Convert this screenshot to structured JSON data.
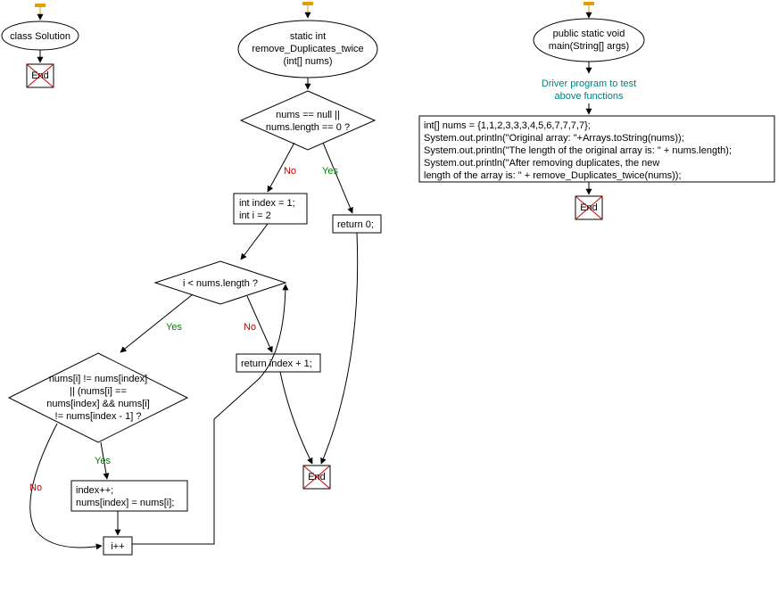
{
  "chart_data": {
    "type": "flowchart",
    "columns": [
      {
        "id": "col1",
        "nodes": [
          {
            "id": "c1_start",
            "type": "start"
          },
          {
            "id": "c1_class",
            "type": "oval",
            "text": "class Solution"
          },
          {
            "id": "c1_end",
            "type": "end"
          }
        ],
        "edges": [
          {
            "from": "c1_start",
            "to": "c1_class"
          },
          {
            "from": "c1_class",
            "to": "c1_end"
          }
        ]
      },
      {
        "id": "col2",
        "nodes": [
          {
            "id": "c2_start",
            "type": "start"
          },
          {
            "id": "c2_func",
            "type": "oval",
            "text_lines": [
              "static int",
              "remove_Duplicates_twice",
              "(int[] nums)"
            ]
          },
          {
            "id": "c2_d1",
            "type": "decision",
            "text_lines": [
              "nums == null ||",
              "nums.length == 0 ?"
            ]
          },
          {
            "id": "c2_ret0",
            "type": "process",
            "text": "return 0;"
          },
          {
            "id": "c2_init",
            "type": "process",
            "text_lines": [
              "int index = 1;",
              "int i = 2"
            ]
          },
          {
            "id": "c2_d2",
            "type": "decision",
            "text": "i < nums.length ?"
          },
          {
            "id": "c2_retidx",
            "type": "process",
            "text": "return index + 1;"
          },
          {
            "id": "c2_d3",
            "type": "decision",
            "text_lines": [
              "nums[i] != nums[index]",
              "|| (nums[i] ==",
              "nums[index] && nums[i]",
              "!= nums[index - 1] ?"
            ]
          },
          {
            "id": "c2_assign",
            "type": "process",
            "text_lines": [
              "index++;",
              "nums[index] = nums[i];"
            ]
          },
          {
            "id": "c2_inc",
            "type": "process",
            "text": "i++"
          },
          {
            "id": "c2_end",
            "type": "end"
          }
        ],
        "edges": [
          {
            "from": "c2_start",
            "to": "c2_func"
          },
          {
            "from": "c2_func",
            "to": "c2_d1"
          },
          {
            "from": "c2_d1",
            "to": "c2_ret0",
            "label": "Yes"
          },
          {
            "from": "c2_d1",
            "to": "c2_init",
            "label": "No"
          },
          {
            "from": "c2_init",
            "to": "c2_d2"
          },
          {
            "from": "c2_d2",
            "to": "c2_d3",
            "label": "Yes"
          },
          {
            "from": "c2_d2",
            "to": "c2_retidx",
            "label": "No"
          },
          {
            "from": "c2_d3",
            "to": "c2_assign",
            "label": "Yes"
          },
          {
            "from": "c2_d3",
            "to": "c2_inc",
            "label": "No"
          },
          {
            "from": "c2_assign",
            "to": "c2_inc"
          },
          {
            "from": "c2_inc",
            "to": "c2_d2"
          },
          {
            "from": "c2_ret0",
            "to": "c2_end"
          },
          {
            "from": "c2_retidx",
            "to": "c2_end"
          }
        ]
      },
      {
        "id": "col3",
        "nodes": [
          {
            "id": "c3_start",
            "type": "start"
          },
          {
            "id": "c3_main",
            "type": "oval",
            "text_lines": [
              "public static void",
              "main(String[] args)"
            ]
          },
          {
            "id": "c3_comment",
            "type": "comment",
            "text_lines": [
              "Driver program to test",
              "above functions"
            ]
          },
          {
            "id": "c3_body",
            "type": "process",
            "text_lines": [
              "int[] nums = {1,1,2,3,3,3,4,5,6,7,7,7,7};",
              "System.out.println(\"Original array: \"+Arrays.toString(nums));",
              "System.out.println(\"The length of the original array is: \" + nums.length);",
              "System.out.println(\"After removing duplicates, the new",
              "length of the array is: \" + remove_Duplicates_twice(nums));"
            ]
          },
          {
            "id": "c3_end",
            "type": "end"
          }
        ],
        "edges": [
          {
            "from": "c3_start",
            "to": "c3_main"
          },
          {
            "from": "c3_main",
            "to": "c3_comment"
          },
          {
            "from": "c3_comment",
            "to": "c3_body"
          },
          {
            "from": "c3_body",
            "to": "c3_end"
          }
        ]
      }
    ]
  },
  "labels": {
    "yes": "Yes",
    "no": "No"
  },
  "col1": {
    "class": "class Solution",
    "end": "End"
  },
  "col2": {
    "func_l1": "static int",
    "func_l2": "remove_Duplicates_twice",
    "func_l3": "(int[] nums)",
    "d1_l1": "nums == null ||",
    "d1_l2": "nums.length == 0 ?",
    "ret0": "return 0;",
    "init_l1": "int index = 1;",
    "init_l2": "int i = 2",
    "d2": "i < nums.length ?",
    "retidx": "return index + 1;",
    "d3_l1": "nums[i] != nums[index]",
    "d3_l2": "|| (nums[i] ==",
    "d3_l3": "nums[index] && nums[i]",
    "d3_l4": "!= nums[index - 1] ?",
    "assign_l1": "index++;",
    "assign_l2": "nums[index] = nums[i];",
    "inc": "i++",
    "end": "End"
  },
  "col3": {
    "main_l1": "public static void",
    "main_l2": "main(String[] args)",
    "comment_l1": "Driver program to test",
    "comment_l2": "above functions",
    "body_l1": "int[] nums = {1,1,2,3,3,3,4,5,6,7,7,7,7};",
    "body_l2": "System.out.println(\"Original array: \"+Arrays.toString(nums));",
    "body_l3": "System.out.println(\"The length of the original array is: \" + nums.length);",
    "body_l4": "System.out.println(\"After removing duplicates, the new",
    "body_l5": "length of the array is: \" + remove_Duplicates_twice(nums));",
    "end": "End"
  }
}
